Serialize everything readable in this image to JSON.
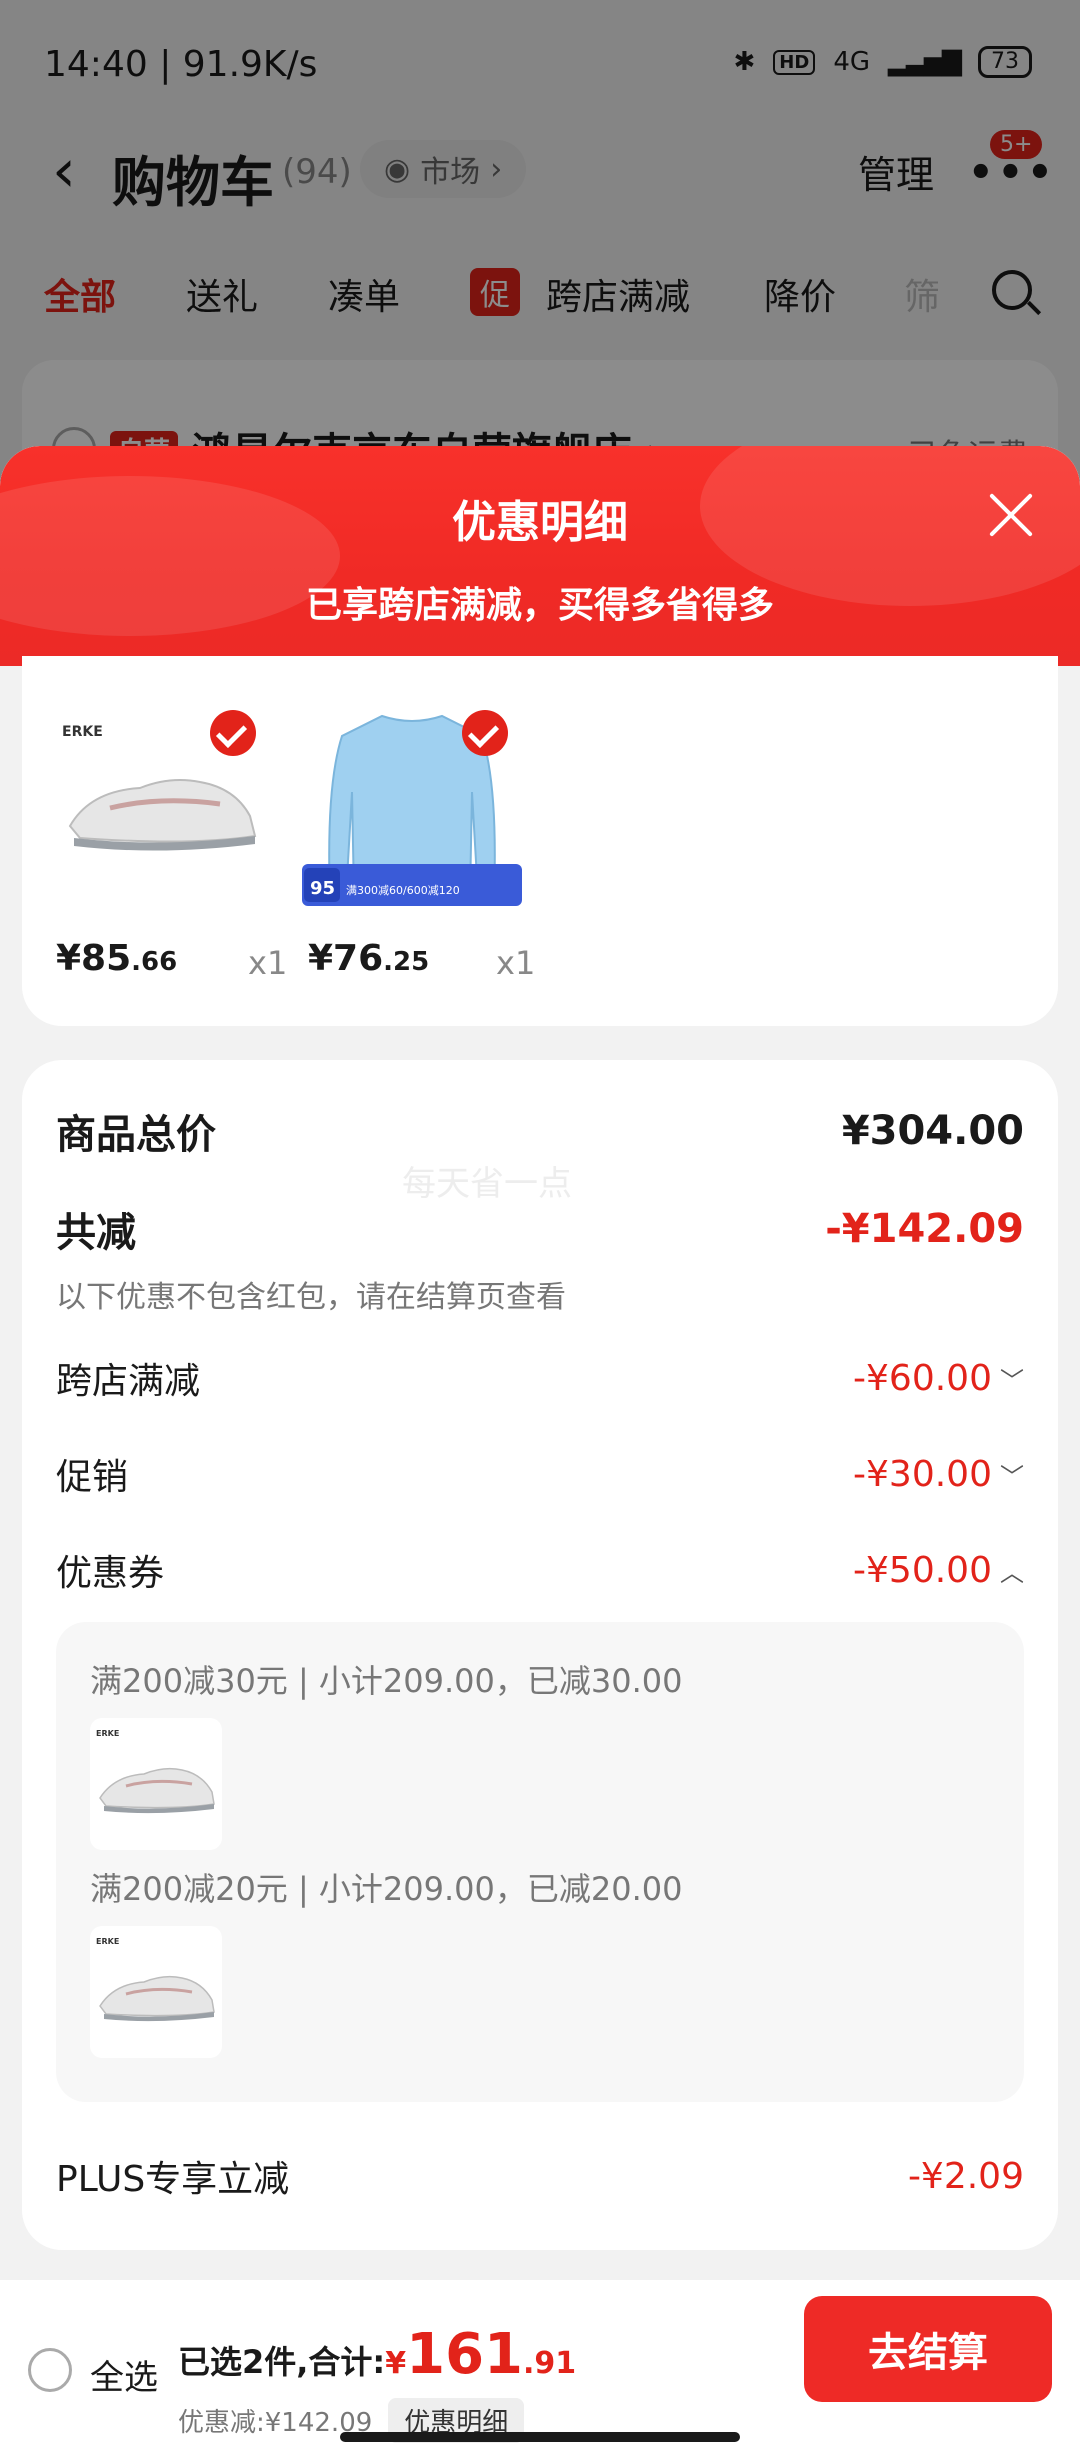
{
  "status_bar": {
    "time": "14:40 | 91.9K/s",
    "hd": "HD",
    "network": "4G",
    "battery": "73"
  },
  "nav": {
    "back": "‹",
    "title": "购物车",
    "count": "(94)",
    "market": "市场",
    "manage": "管理",
    "more_badge": "5+"
  },
  "tabs": [
    "全部",
    "送礼",
    "凑单",
    "促",
    "跨店满减",
    "降价",
    "筛"
  ],
  "store": {
    "tag": "自营",
    "name": "鸿星尔克京东自营旗舰店 ›",
    "shipping": "已免运费"
  },
  "sheet": {
    "title": "优惠明细",
    "subtitle": "已享跨店满减，买得多省得多"
  },
  "goods": [
    {
      "price_int": "¥85",
      "price_dec": ".66",
      "qty": "x1",
      "brand": "ERKE"
    },
    {
      "price_int": "¥76",
      "price_dec": ".25",
      "qty": "x1",
      "badge_num": "95",
      "banner_text": "满300减60/600减120"
    }
  ],
  "detail": {
    "watermark": "每天省一点",
    "total_label": "商品总价",
    "total_value": "¥304.00",
    "reduce_label": "共减",
    "reduce_value": "-¥142.09",
    "note": "以下优惠不包含红包，请在结算页查看",
    "cross_label": "跨店满减",
    "cross_value": "-¥60.00",
    "promo_label": "促销",
    "promo_value": "-¥30.00",
    "coupon_label": "优惠券",
    "coupon_value": "-¥50.00",
    "coupon1": "满200减30元 | 小计209.00，已减30.00",
    "coupon2": "满200减20元 | 小计209.00，已减20.00",
    "plus_label": "PLUS专享立减",
    "plus_value": "-¥2.09"
  },
  "bottom": {
    "select_all": "全选",
    "selected_text": "已选2件,合计:",
    "currency": "¥",
    "total_int": "161",
    "total_dec": ".91",
    "discount_text": "优惠减:¥142.09",
    "detail_btn": "优惠明细",
    "checkout": "去结算"
  },
  "colors": {
    "accent": "#e2231a",
    "header_red": "#f8312b"
  }
}
